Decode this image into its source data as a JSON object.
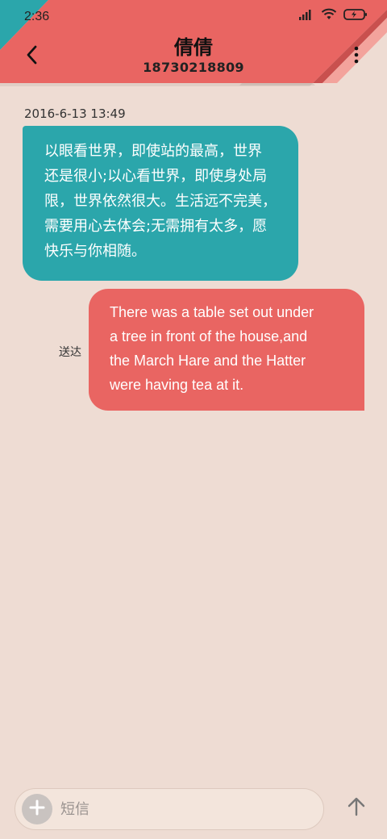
{
  "status_bar": {
    "time": "2:36",
    "icons": [
      "signal-icon",
      "wifi-icon",
      "battery-icon"
    ]
  },
  "header": {
    "contact_name": "倩倩",
    "contact_number": "18730218809",
    "back_icon": "chevron-left-icon",
    "more_icon": "more-vertical-icon"
  },
  "conversation": {
    "timestamp": "2016-6-13 13:49",
    "incoming": {
      "lines": [
        "以眼看世界，即使站的最高，世界",
        "还是很小;以心看世界，即使身处局",
        "限，世界依然很大。生活远不完美，",
        "需要用心去体会;无需拥有太多，愿",
        "快乐与你相随。"
      ]
    },
    "outgoing": {
      "lines": [
        "There was a table set out under",
        "a tree in front of the house,and",
        "the March Hare and the Hatter",
        "were having tea at it."
      ],
      "status": "送达"
    }
  },
  "composer": {
    "placeholder": "短信",
    "add_icon": "plus-icon",
    "send_icon": "arrow-up-icon"
  },
  "colors": {
    "background": "#eedcd3",
    "incoming_bubble": "#2ba6ab",
    "outgoing_bubble": "#e96562",
    "header_red": "#e96562",
    "header_pink": "#f3a39c",
    "header_teal": "#2ba6ab"
  }
}
